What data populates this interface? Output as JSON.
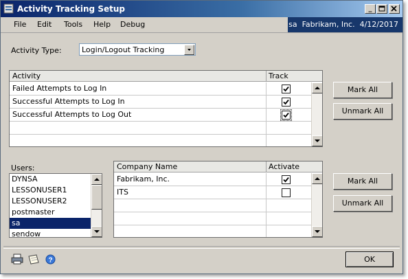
{
  "window": {
    "title": "Activity Tracking Setup"
  },
  "menu": [
    "File",
    "Edit",
    "Tools",
    "Help",
    "Debug"
  ],
  "user_info": "sa  Fabrikam, Inc.  4/12/2017",
  "activity_type": {
    "label": "Activity Type:",
    "value": "Login/Logout Tracking"
  },
  "activity_grid": {
    "headers": {
      "activity": "Activity",
      "track": "Track"
    },
    "rows": [
      {
        "activity": "Failed Attempts to Log In",
        "track": true
      },
      {
        "activity": "Successful Attempts to Log In",
        "track": true
      },
      {
        "activity": "Successful Attempts to Log Out",
        "track": true
      }
    ]
  },
  "activity_buttons": {
    "mark_all": "Mark All",
    "unmark_all": "Unmark All"
  },
  "users": {
    "label": "Users:",
    "items": [
      "DYNSA",
      "LESSONUSER1",
      "LESSONUSER2",
      "postmaster",
      "sa",
      "sendow"
    ],
    "selected": "sa"
  },
  "company_grid": {
    "headers": {
      "company": "Company Name",
      "activate": "Activate"
    },
    "rows": [
      {
        "company": "Fabrikam, Inc.",
        "activate": true
      },
      {
        "company": "ITS",
        "activate": false
      }
    ]
  },
  "company_buttons": {
    "mark_all": "Mark All",
    "unmark_all": "Unmark All"
  },
  "footer": {
    "ok": "OK"
  },
  "colors": {
    "title_bar": "#0a246a",
    "user_bar": "#17376b",
    "selection": "#0a246a",
    "window_bg": "#d4d0c8"
  }
}
